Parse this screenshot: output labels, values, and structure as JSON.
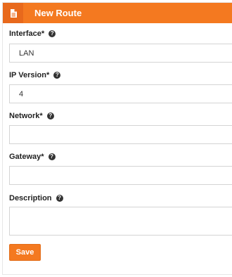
{
  "header": {
    "title": "New Route",
    "icon": "document-icon",
    "color": "#f47920"
  },
  "fields": {
    "interface": {
      "label": "Interface*",
      "value": "LAN"
    },
    "ip_version": {
      "label": "IP Version*",
      "value": "4"
    },
    "network": {
      "label": "Network*",
      "value": ""
    },
    "gateway": {
      "label": "Gateway*",
      "value": ""
    },
    "description": {
      "label": "Description",
      "value": ""
    }
  },
  "actions": {
    "save_label": "Save"
  }
}
